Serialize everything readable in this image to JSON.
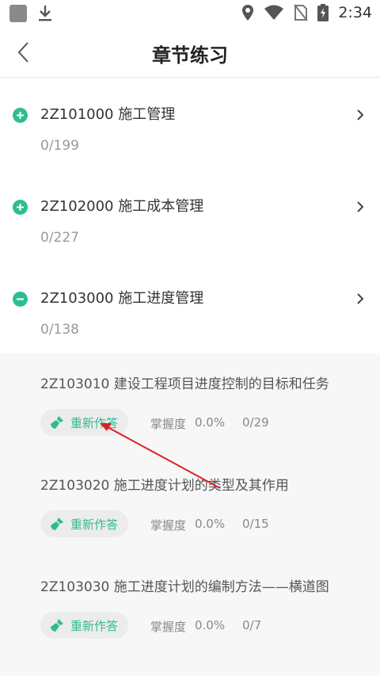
{
  "status_bar": {
    "time": "2:34",
    "icons": [
      "app-square-icon",
      "download-icon",
      "location-icon",
      "wifi-icon",
      "no-sim-icon",
      "battery-charging-icon"
    ]
  },
  "header": {
    "title": "章节练习",
    "back_icon": "chevron-left-icon"
  },
  "chapters": [
    {
      "code_title": "2Z101000 施工管理",
      "progress": "0/199",
      "state": "collapsed"
    },
    {
      "code_title": "2Z102000 施工成本管理",
      "progress": "0/227",
      "state": "collapsed"
    },
    {
      "code_title": "2Z103000 施工进度管理",
      "progress": "0/138",
      "state": "expanded"
    }
  ],
  "sections": [
    {
      "title": "2Z103010 建设工程项目进度控制的目标和任务",
      "redo_label": "重新作答",
      "mastery_label": "掌握度",
      "mastery_value": "0.0%",
      "count": "0/29"
    },
    {
      "title": "2Z103020 施工进度计划的类型及其作用",
      "redo_label": "重新作答",
      "mastery_label": "掌握度",
      "mastery_value": "0.0%",
      "count": "0/15"
    },
    {
      "title": "2Z103030 施工进度计划的编制方法——横道图",
      "redo_label": "重新作答",
      "mastery_label": "掌握度",
      "mastery_value": "0.0%",
      "count": "0/7"
    }
  ],
  "colors": {
    "accent": "#2dbd91",
    "annotation": "#e02020",
    "sub_background": "#f7f7f7"
  }
}
